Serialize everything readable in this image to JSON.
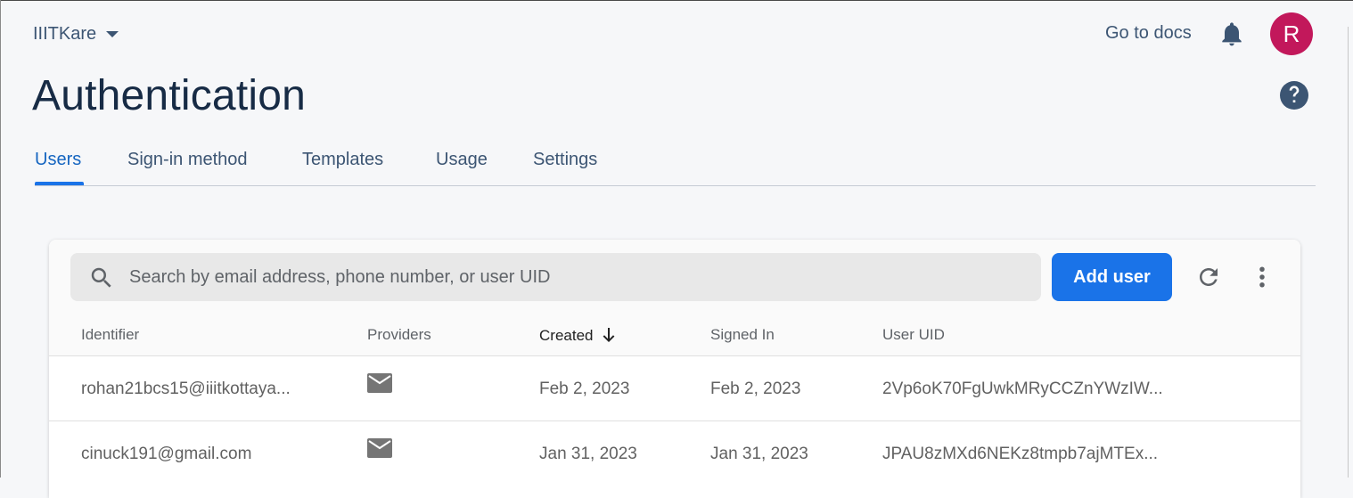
{
  "header": {
    "project_name": "IIITKare",
    "go_to_docs": "Go to docs",
    "avatar_initial": "R"
  },
  "page": {
    "title": "Authentication"
  },
  "tabs": [
    {
      "label": "Users",
      "active": true
    },
    {
      "label": "Sign-in method",
      "active": false
    },
    {
      "label": "Templates",
      "active": false
    },
    {
      "label": "Usage",
      "active": false
    },
    {
      "label": "Settings",
      "active": false
    }
  ],
  "users_table": {
    "search_placeholder": "Search by email address, phone number, or user UID",
    "search_value": "",
    "add_user_label": "Add user",
    "columns": [
      "Identifier",
      "Providers",
      "Created",
      "Signed In",
      "User UID"
    ],
    "sorted_column": "Created",
    "sort_direction": "descending",
    "rows": [
      {
        "identifier": "rohan21bcs15@iiitkottaya...",
        "provider": "email-icon",
        "created": "Feb 2, 2023",
        "signed_in": "Feb 2, 2023",
        "uid": "2Vp6oK70FgUwkMRyCCZnYWzIW..."
      },
      {
        "identifier": "cinuck191@gmail.com",
        "provider": "email-icon",
        "created": "Jan 31, 2023",
        "signed_in": "Jan 31, 2023",
        "uid": "JPAU8zMXd6NEKz8tmpb7ajMTEx..."
      }
    ]
  },
  "colors": {
    "primary_blue": "#1a73e8",
    "active_tab_text": "#1565c0",
    "avatar_bg": "#c2185b",
    "header_text": "#3c5573",
    "title_text": "#172b45",
    "page_bg": "#f6f7f9"
  },
  "icons": {
    "project_menu": "chevron-down-icon",
    "notifications": "bell-icon",
    "help": "help-circle-icon",
    "search": "search-icon",
    "refresh": "refresh-icon",
    "more": "more-vert-icon",
    "sort": "arrow-down-icon"
  }
}
